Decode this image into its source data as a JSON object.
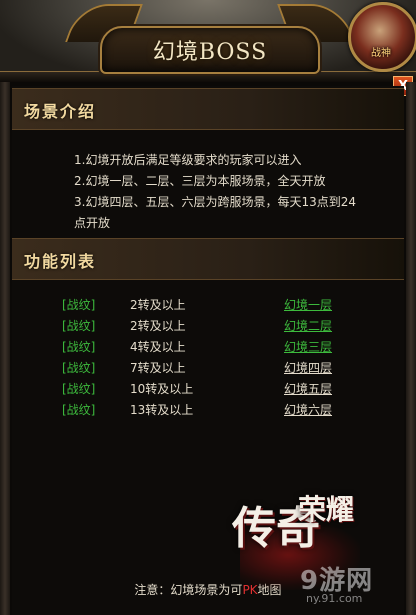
{
  "window": {
    "title": "幻境BOSS",
    "close_label": "X",
    "avatar_label": "战神"
  },
  "sections": {
    "intro_title": "场景介绍",
    "functions_title": "功能列表"
  },
  "intro_lines": [
    "1.幻境开放后满足等级要求的玩家可以进入",
    "2.幻境一层、二层、三层为本服场景，全天开放",
    "3.幻境四层、五层、六层为跨服场景，每天13点到24",
    "点开放"
  ],
  "function_rows": [
    {
      "tag": "[战纹]",
      "requirement": "2转及以上",
      "link": "幻境一层",
      "link_color": "#3dbb3d"
    },
    {
      "tag": "[战纹]",
      "requirement": "2转及以上",
      "link": "幻境二层",
      "link_color": "#3dbb3d"
    },
    {
      "tag": "[战纹]",
      "requirement": "4转及以上",
      "link": "幻境三层",
      "link_color": "#3dbb3d"
    },
    {
      "tag": "[战纹]",
      "requirement": "7转及以上",
      "link": "幻境四层",
      "link_color": "#e4dccb"
    },
    {
      "tag": "[战纹]",
      "requirement": "10转及以上",
      "link": "幻境五层",
      "link_color": "#e4dccb"
    },
    {
      "tag": "[战纹]",
      "requirement": "13转及以上",
      "link": "幻境六层",
      "link_color": "#e4dccb"
    }
  ],
  "footer": {
    "note_prefix": "注意：幻境场景为可",
    "note_pk": "PK",
    "note_suffix": "地图"
  },
  "logo": {
    "main": "传奇",
    "sub": "荣耀"
  },
  "watermark": {
    "text": "9游网",
    "url": "ny.91.com"
  },
  "colors": {
    "tag_green": "#3dbb3d",
    "pk_red": "#e23030",
    "header_gold": "#f2d9a0"
  }
}
